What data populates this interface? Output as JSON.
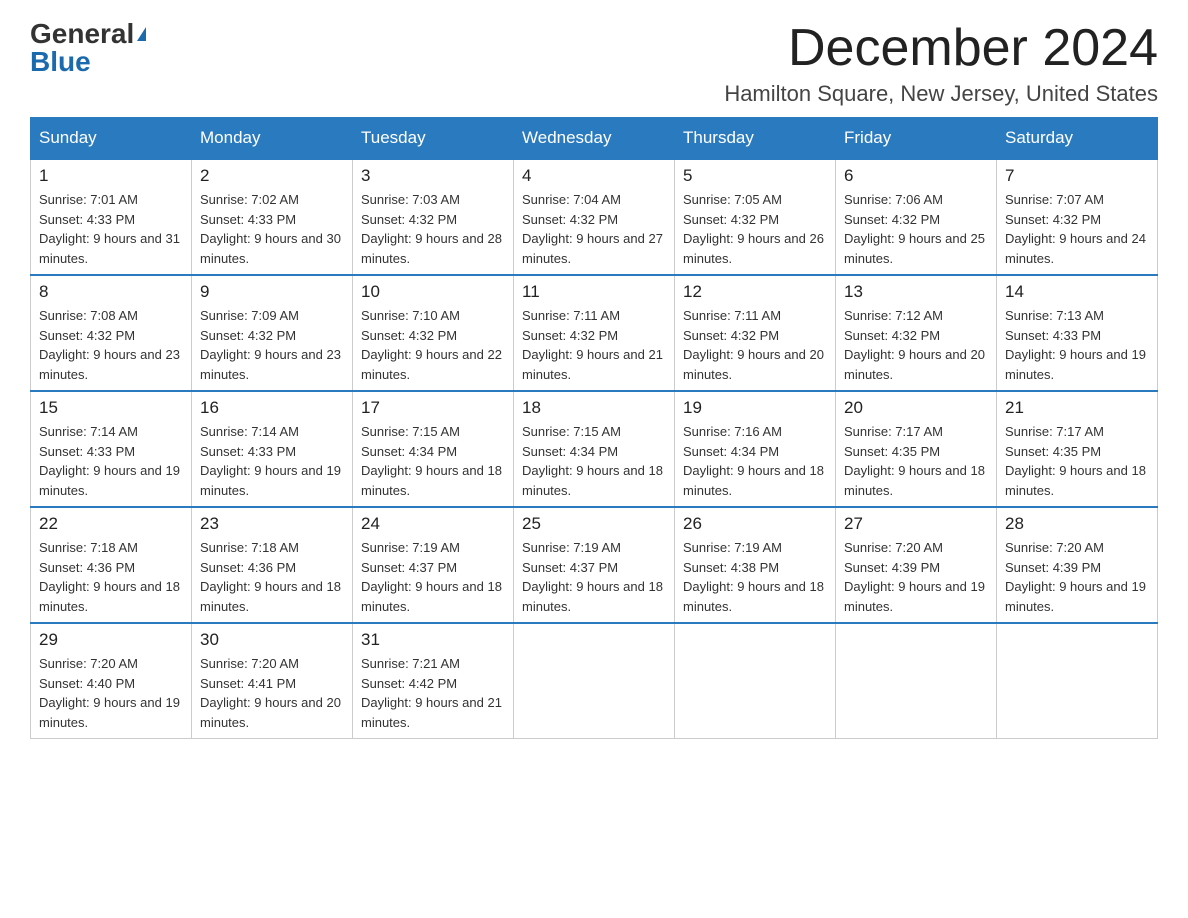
{
  "logo": {
    "general": "General",
    "blue": "Blue"
  },
  "title": "December 2024",
  "location": "Hamilton Square, New Jersey, United States",
  "headers": [
    "Sunday",
    "Monday",
    "Tuesday",
    "Wednesday",
    "Thursday",
    "Friday",
    "Saturday"
  ],
  "weeks": [
    [
      {
        "num": "1",
        "sunrise": "7:01 AM",
        "sunset": "4:33 PM",
        "daylight": "9 hours and 31 minutes."
      },
      {
        "num": "2",
        "sunrise": "7:02 AM",
        "sunset": "4:33 PM",
        "daylight": "9 hours and 30 minutes."
      },
      {
        "num": "3",
        "sunrise": "7:03 AM",
        "sunset": "4:32 PM",
        "daylight": "9 hours and 28 minutes."
      },
      {
        "num": "4",
        "sunrise": "7:04 AM",
        "sunset": "4:32 PM",
        "daylight": "9 hours and 27 minutes."
      },
      {
        "num": "5",
        "sunrise": "7:05 AM",
        "sunset": "4:32 PM",
        "daylight": "9 hours and 26 minutes."
      },
      {
        "num": "6",
        "sunrise": "7:06 AM",
        "sunset": "4:32 PM",
        "daylight": "9 hours and 25 minutes."
      },
      {
        "num": "7",
        "sunrise": "7:07 AM",
        "sunset": "4:32 PM",
        "daylight": "9 hours and 24 minutes."
      }
    ],
    [
      {
        "num": "8",
        "sunrise": "7:08 AM",
        "sunset": "4:32 PM",
        "daylight": "9 hours and 23 minutes."
      },
      {
        "num": "9",
        "sunrise": "7:09 AM",
        "sunset": "4:32 PM",
        "daylight": "9 hours and 23 minutes."
      },
      {
        "num": "10",
        "sunrise": "7:10 AM",
        "sunset": "4:32 PM",
        "daylight": "9 hours and 22 minutes."
      },
      {
        "num": "11",
        "sunrise": "7:11 AM",
        "sunset": "4:32 PM",
        "daylight": "9 hours and 21 minutes."
      },
      {
        "num": "12",
        "sunrise": "7:11 AM",
        "sunset": "4:32 PM",
        "daylight": "9 hours and 20 minutes."
      },
      {
        "num": "13",
        "sunrise": "7:12 AM",
        "sunset": "4:32 PM",
        "daylight": "9 hours and 20 minutes."
      },
      {
        "num": "14",
        "sunrise": "7:13 AM",
        "sunset": "4:33 PM",
        "daylight": "9 hours and 19 minutes."
      }
    ],
    [
      {
        "num": "15",
        "sunrise": "7:14 AM",
        "sunset": "4:33 PM",
        "daylight": "9 hours and 19 minutes."
      },
      {
        "num": "16",
        "sunrise": "7:14 AM",
        "sunset": "4:33 PM",
        "daylight": "9 hours and 19 minutes."
      },
      {
        "num": "17",
        "sunrise": "7:15 AM",
        "sunset": "4:34 PM",
        "daylight": "9 hours and 18 minutes."
      },
      {
        "num": "18",
        "sunrise": "7:15 AM",
        "sunset": "4:34 PM",
        "daylight": "9 hours and 18 minutes."
      },
      {
        "num": "19",
        "sunrise": "7:16 AM",
        "sunset": "4:34 PM",
        "daylight": "9 hours and 18 minutes."
      },
      {
        "num": "20",
        "sunrise": "7:17 AM",
        "sunset": "4:35 PM",
        "daylight": "9 hours and 18 minutes."
      },
      {
        "num": "21",
        "sunrise": "7:17 AM",
        "sunset": "4:35 PM",
        "daylight": "9 hours and 18 minutes."
      }
    ],
    [
      {
        "num": "22",
        "sunrise": "7:18 AM",
        "sunset": "4:36 PM",
        "daylight": "9 hours and 18 minutes."
      },
      {
        "num": "23",
        "sunrise": "7:18 AM",
        "sunset": "4:36 PM",
        "daylight": "9 hours and 18 minutes."
      },
      {
        "num": "24",
        "sunrise": "7:19 AM",
        "sunset": "4:37 PM",
        "daylight": "9 hours and 18 minutes."
      },
      {
        "num": "25",
        "sunrise": "7:19 AM",
        "sunset": "4:37 PM",
        "daylight": "9 hours and 18 minutes."
      },
      {
        "num": "26",
        "sunrise": "7:19 AM",
        "sunset": "4:38 PM",
        "daylight": "9 hours and 18 minutes."
      },
      {
        "num": "27",
        "sunrise": "7:20 AM",
        "sunset": "4:39 PM",
        "daylight": "9 hours and 19 minutes."
      },
      {
        "num": "28",
        "sunrise": "7:20 AM",
        "sunset": "4:39 PM",
        "daylight": "9 hours and 19 minutes."
      }
    ],
    [
      {
        "num": "29",
        "sunrise": "7:20 AM",
        "sunset": "4:40 PM",
        "daylight": "9 hours and 19 minutes."
      },
      {
        "num": "30",
        "sunrise": "7:20 AM",
        "sunset": "4:41 PM",
        "daylight": "9 hours and 20 minutes."
      },
      {
        "num": "31",
        "sunrise": "7:21 AM",
        "sunset": "4:42 PM",
        "daylight": "9 hours and 21 minutes."
      },
      null,
      null,
      null,
      null
    ]
  ]
}
